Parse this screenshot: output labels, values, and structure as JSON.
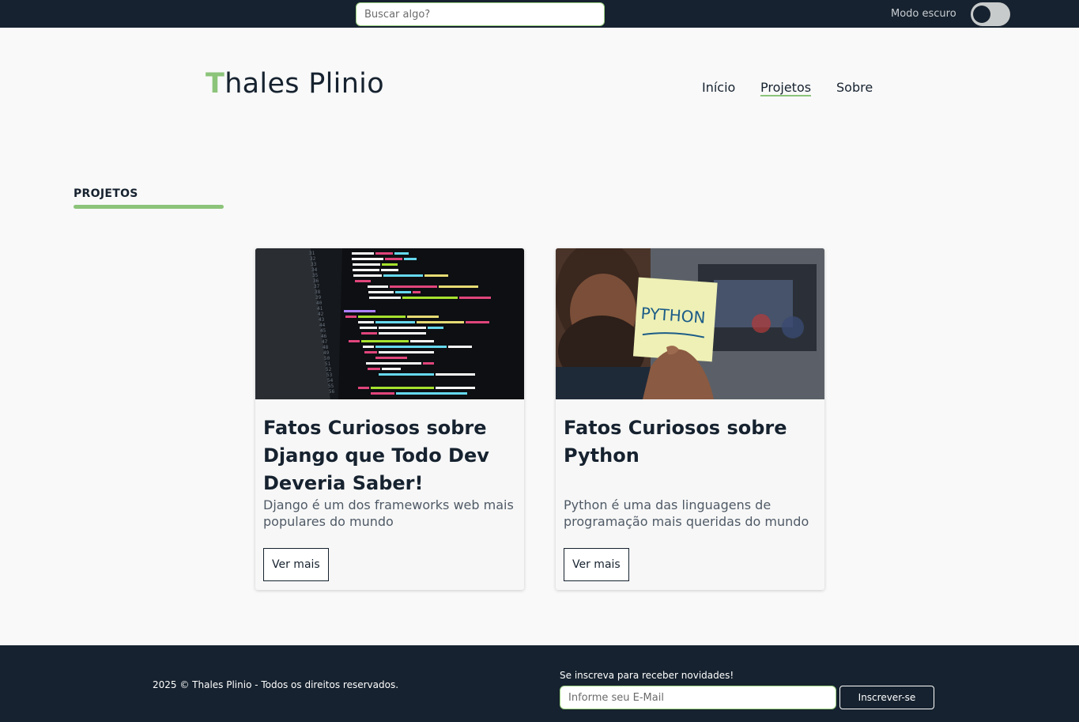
{
  "topbar": {
    "search_placeholder": "Buscar algo?",
    "dark_mode_label": "Modo escuro",
    "dark_mode_on": false
  },
  "header": {
    "logo_first": "T",
    "logo_rest": "hales Plinio",
    "nav": [
      {
        "label": "Início"
      },
      {
        "label": "Projetos",
        "active": true
      },
      {
        "label": "Sobre"
      }
    ]
  },
  "section": {
    "title": "PROJETOS"
  },
  "projects": [
    {
      "title": "Fatos Curiosos sobre Django que Todo Dev Deveria Saber!",
      "description": "Django é um dos frameworks web mais populares do mundo",
      "button": "Ver mais",
      "image_icon": "code-screen-image"
    },
    {
      "title": "Fatos Curiosos sobre Python",
      "description": "Python é uma das linguagens de programação mais queridas do mundo",
      "button": "Ver mais",
      "image_icon": "python-note-image",
      "image_text": "PYTHON"
    }
  ],
  "footer": {
    "copyright": "2025 © Thales Plinio - Todos os direitos reservados.",
    "newsletter_label": "Se inscreva para receber novidades!",
    "email_placeholder": "Informe seu E-Mail",
    "subscribe_label": "Inscrever-se"
  },
  "colors": {
    "navy": "#16222f",
    "accent": "#8cc47a",
    "background": "#f9f9f9"
  }
}
